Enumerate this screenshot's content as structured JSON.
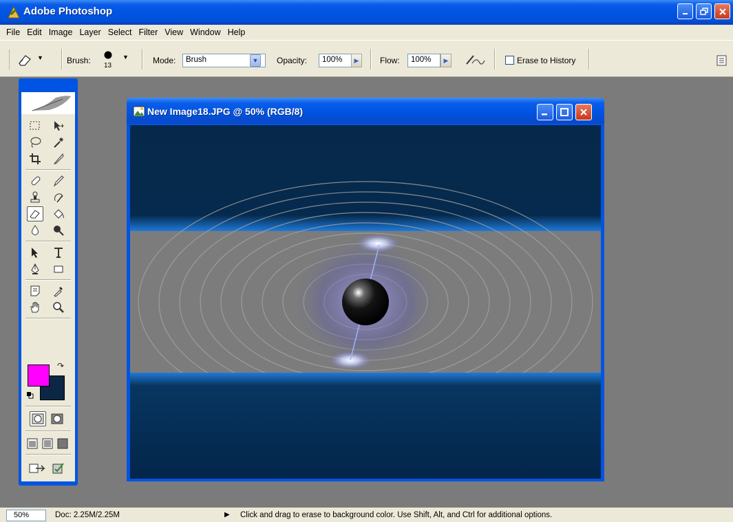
{
  "app": {
    "title": "Adobe Photoshop",
    "window_buttons": [
      "minimize",
      "restore",
      "close"
    ]
  },
  "menubar": {
    "items": [
      "File",
      "Edit",
      "Image",
      "Layer",
      "Select",
      "Filter",
      "View",
      "Window",
      "Help"
    ]
  },
  "options_bar": {
    "tool_icon": "eraser-icon",
    "brush_label": "Brush:",
    "brush_size": "13",
    "mode_label": "Mode:",
    "mode_value": "Brush",
    "opacity_label": "Opacity:",
    "opacity_value": "100%",
    "flow_label": "Flow:",
    "flow_value": "100%",
    "airbrush_icon": "airbrush-icon",
    "erase_to_history_label": "Erase to History",
    "erase_to_history_checked": false,
    "palette_well_icon": "palette-well-icon"
  },
  "toolbox": {
    "header_icon": "feather-icon",
    "tools": [
      [
        "marquee-icon",
        "move-icon"
      ],
      [
        "lasso-icon",
        "magic-wand-icon"
      ],
      [
        "crop-icon",
        "slice-icon"
      ],
      [
        "healing-brush-icon",
        "brush-icon"
      ],
      [
        "clone-stamp-icon",
        "history-brush-icon"
      ],
      [
        "eraser-icon",
        "paint-bucket-icon"
      ],
      [
        "blur-icon",
        "dodge-icon"
      ],
      [
        "path-selection-icon",
        "type-icon"
      ],
      [
        "pen-icon",
        "rectangle-shape-icon"
      ],
      [
        "notes-icon",
        "eyedropper-icon"
      ],
      [
        "hand-icon",
        "zoom-icon"
      ]
    ],
    "selected_tool": "eraser-icon",
    "foreground_color": "#ff00ff",
    "background_color": "#0b2744",
    "mode_buttons": [
      "standard-mode-icon",
      "quickmask-mode-icon"
    ],
    "screen_modes": [
      "standard-screen-icon",
      "full-screen-menu-icon",
      "full-screen-icon"
    ],
    "jump_buttons": [
      "imageready-jump-icon",
      "check-icon"
    ]
  },
  "document": {
    "title": "New Image18.JPG @ 50% (RGB/8)",
    "window_buttons": [
      "minimize",
      "maximize",
      "close"
    ],
    "canvas_colors": {
      "background": "#04284a",
      "strip": "#7c7c7c",
      "sphere": "#000000"
    }
  },
  "statusbar": {
    "zoom": "50%",
    "doc_info": "Doc: 2.25M/2.25M",
    "message": "Click and drag to erase to background color.  Use Shift, Alt, and Ctrl for additional options."
  }
}
